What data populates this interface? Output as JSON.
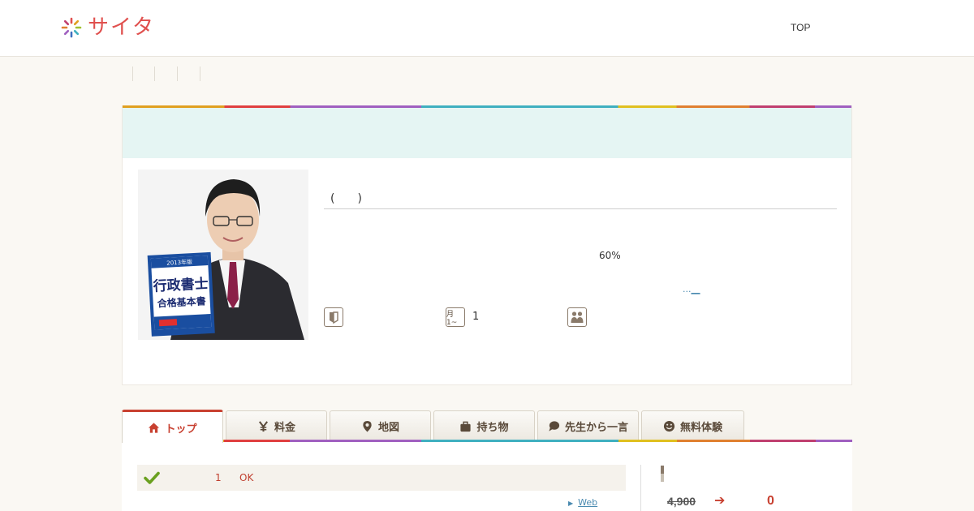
{
  "header": {
    "logo_text": "サイタ",
    "nav_top": "TOP"
  },
  "profile": {
    "name_paren": "(　　)",
    "percent": "60%",
    "more_link_dots": "...",
    "more_link_text": "__",
    "schedule_value": "1",
    "photo_book_year": "2013年版",
    "photo_book_title_1": "行政書士",
    "photo_book_title_2": "合格基本書"
  },
  "info_icons": [
    {
      "icon": "beginner-mark-icon"
    },
    {
      "icon": "calendar-icon",
      "label": "月1~"
    },
    {
      "icon": "people-icon"
    }
  ],
  "tabs": [
    {
      "label": "トップ",
      "icon": "home-icon",
      "active": true
    },
    {
      "label": "料金",
      "icon": "yen-icon",
      "active": false
    },
    {
      "label": "地図",
      "icon": "map-pin-icon",
      "active": false
    },
    {
      "label": "持ち物",
      "icon": "bag-icon",
      "active": false
    },
    {
      "label": "先生から一言",
      "icon": "speech-bubble-icon",
      "active": false
    },
    {
      "label": "無料体験",
      "icon": "smile-icon",
      "active": false
    }
  ],
  "content": {
    "feature_num": "1",
    "feature_ok": "OK",
    "web_link": "Web",
    "price_old": "4,900",
    "price_arrow": "➔",
    "price_new": "0"
  },
  "colors": {
    "accent_red": "#c84030",
    "logo_red": "#e0504e",
    "banner_teal": "#e5f5f3",
    "link_blue": "#4a8ab0"
  }
}
